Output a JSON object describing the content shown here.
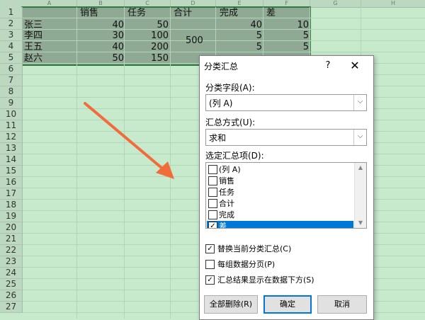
{
  "spreadsheet": {
    "columns": [
      "A",
      "B",
      "C",
      "D",
      "E",
      "F",
      "G",
      "H"
    ],
    "rows": [
      "1",
      "2",
      "3",
      "4",
      "5",
      "6",
      "7",
      "8",
      "9",
      "10",
      "11",
      "12",
      "13",
      "14",
      "15",
      "16",
      "17",
      "18",
      "19",
      "20",
      "21",
      "22",
      "23",
      "24",
      "25",
      "26",
      "27"
    ],
    "headers": [
      "销售",
      "任务",
      "合计",
      "完成",
      "差"
    ],
    "data": [
      {
        "name": "张三",
        "sales": "40",
        "task": "50",
        "done": "40",
        "diff": "10"
      },
      {
        "name": "李四",
        "sales": "30",
        "task": "100",
        "done": "5",
        "diff": "5"
      },
      {
        "name": "王五",
        "sales": "40",
        "task": "200",
        "done": "5",
        "diff": "5"
      },
      {
        "name": "赵六",
        "sales": "50",
        "task": "150",
        "done": "5",
        "diff": "5"
      }
    ],
    "total": "500"
  },
  "dialog": {
    "title": "分类汇总",
    "help": "?",
    "close": "✕",
    "group_field_label": "分类字段(A):",
    "group_field_value": "(列 A)",
    "func_label": "汇总方式(U):",
    "func_value": "求和",
    "items_label": "选定汇总项(D):",
    "items": [
      {
        "label": "(列 A)",
        "checked": false,
        "selected": false
      },
      {
        "label": "销售",
        "checked": false,
        "selected": false
      },
      {
        "label": "任务",
        "checked": false,
        "selected": false
      },
      {
        "label": "合计",
        "checked": false,
        "selected": false
      },
      {
        "label": "完成",
        "checked": false,
        "selected": false
      },
      {
        "label": "差",
        "checked": true,
        "selected": true
      }
    ],
    "opt_replace": "替换当前分类汇总(C)",
    "opt_replace_checked": true,
    "opt_pagebreak": "每组数据分页(P)",
    "opt_pagebreak_checked": false,
    "opt_below": "汇总结果显示在数据下方(S)",
    "opt_below_checked": true,
    "btn_remove": "全部删除(R)",
    "btn_ok": "确定",
    "btn_cancel": "取消",
    "check_mark": "✓",
    "dropdown_arrow": "⌵"
  },
  "colors": {
    "arrow": "#f26b3a",
    "selection": "#0078d7",
    "sheet_bg": "#c7e9cc"
  }
}
